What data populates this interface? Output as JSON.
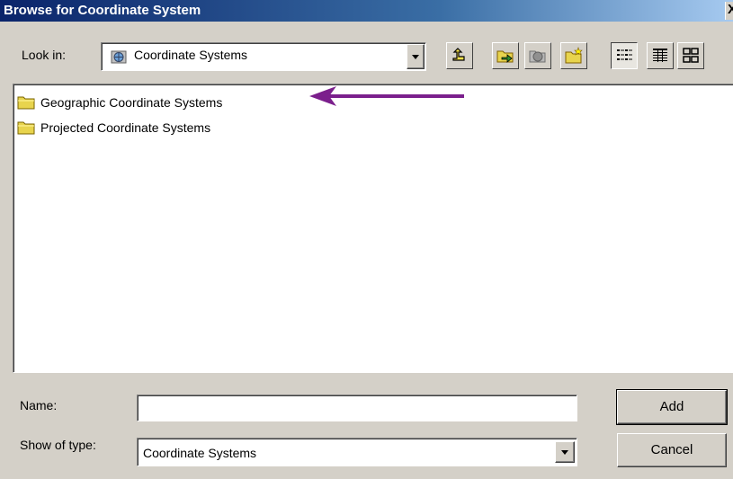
{
  "window": {
    "title": "Browse for Coordinate System",
    "close_glyph": "X"
  },
  "toolbar": {
    "look_in_label": "Look in:",
    "look_in_value": "Coordinate Systems",
    "buttons": [
      {
        "icon": "up-one-level-icon"
      },
      {
        "icon": "connect-folder-icon"
      },
      {
        "icon": "disconnect-folder-icon"
      },
      {
        "icon": "new-folder-icon"
      },
      {
        "icon": "list-view-icon"
      },
      {
        "icon": "details-view-icon"
      },
      {
        "icon": "thumbnails-view-icon"
      }
    ]
  },
  "files": [
    {
      "label": "Geographic Coordinate Systems",
      "icon": "folder-icon"
    },
    {
      "label": "Projected Coordinate Systems",
      "icon": "folder-icon"
    }
  ],
  "annotation": {
    "color": "#7b1f8c",
    "icon": "arrow-left-icon"
  },
  "form": {
    "name_label": "Name:",
    "name_value": "",
    "type_label": "Show of type:",
    "type_value": "Coordinate Systems"
  },
  "actions": {
    "add_label": "Add",
    "cancel_label": "Cancel"
  },
  "colors": {
    "titlebar_start": "#0a246a",
    "titlebar_end": "#a6caf0",
    "face": "#d4d0c8",
    "folder": "#e8d44d"
  }
}
